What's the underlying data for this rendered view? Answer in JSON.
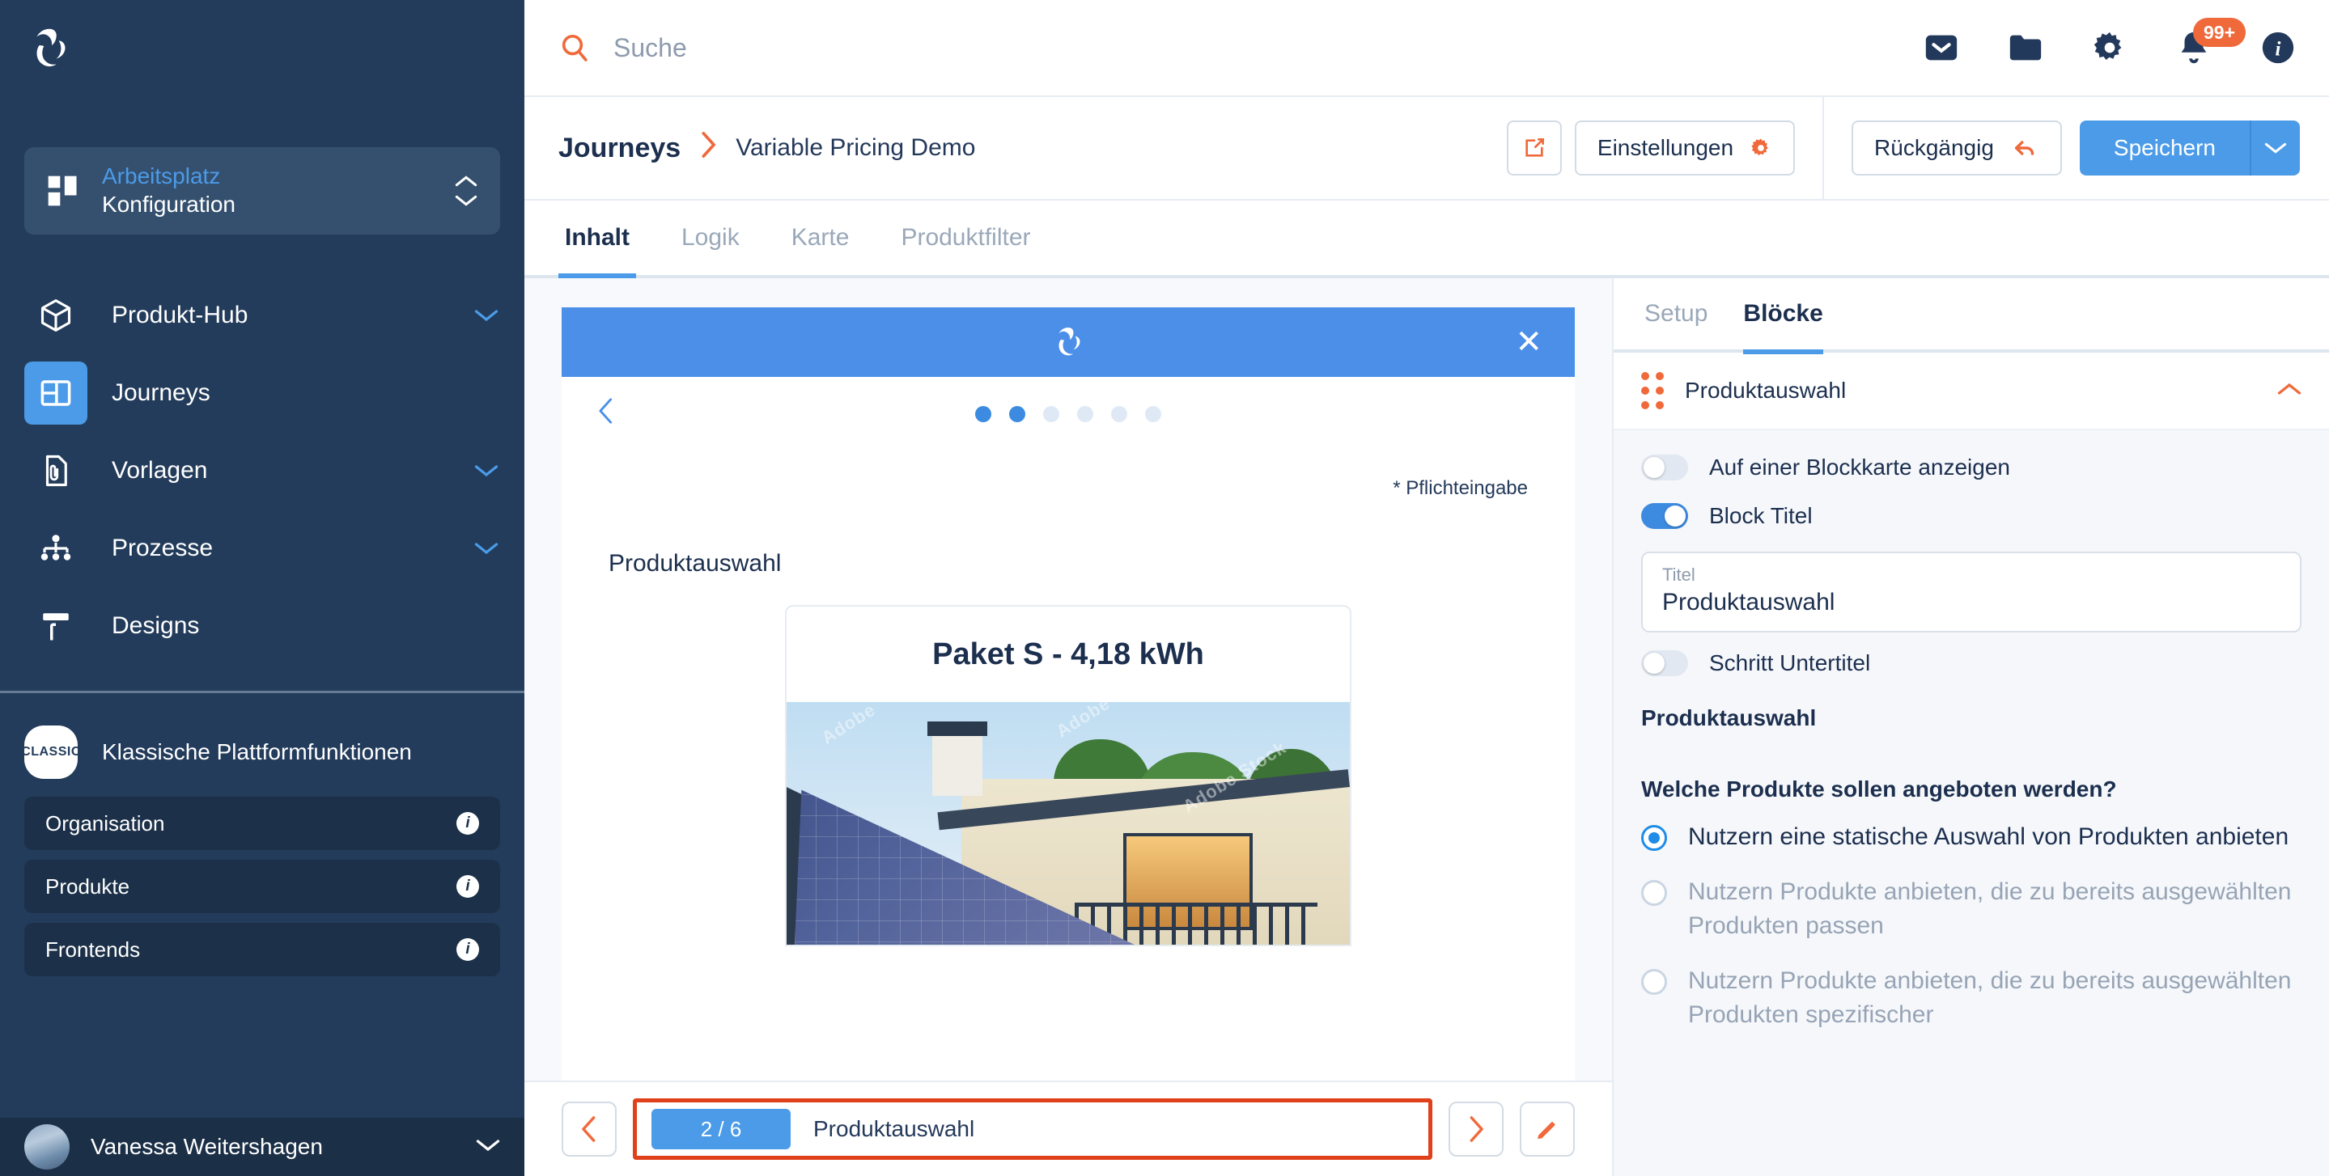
{
  "sidebar": {
    "logo_icon": "refresh-loop-logo",
    "workspace": {
      "icon": "dashboard-grid-icon",
      "top_label": "Arbeitsplatz",
      "bottom_label": "Konfiguration",
      "chevron_up_icon": "chevron-up-icon",
      "chevron_down_icon": "chevron-down-icon"
    },
    "nav_items": [
      {
        "label": "Produkt-Hub",
        "icon": "cube-icon",
        "active": false,
        "has_chevron": true
      },
      {
        "label": "Journeys",
        "icon": "layout-panels-icon",
        "active": true,
        "has_chevron": false
      },
      {
        "label": "Vorlagen",
        "icon": "document-clip-icon",
        "active": false,
        "has_chevron": true
      },
      {
        "label": "Prozesse",
        "icon": "org-tree-icon",
        "active": false,
        "has_chevron": true
      },
      {
        "label": "Designs",
        "icon": "paint-roller-icon",
        "active": false,
        "has_chevron": false
      }
    ],
    "classic": {
      "badge": "CLASSIC",
      "title": "Klassische Plattformfunktionen",
      "items": [
        {
          "label": "Organisation",
          "info_icon": "info-icon"
        },
        {
          "label": "Produkte",
          "info_icon": "info-icon"
        },
        {
          "label": "Frontends",
          "info_icon": "info-icon"
        }
      ]
    },
    "user": {
      "name": "Vanessa Weitershagen",
      "chevron_icon": "chevron-down-icon"
    }
  },
  "topbar": {
    "search_icon": "search-icon",
    "search_placeholder": "Suche",
    "search_value": "",
    "icons": [
      {
        "name": "mail-icon",
        "badge": ""
      },
      {
        "name": "folder-icon",
        "badge": ""
      },
      {
        "name": "gear-icon",
        "badge": ""
      },
      {
        "name": "bell-icon",
        "badge": "99+"
      },
      {
        "name": "info-circle-icon",
        "badge": ""
      }
    ],
    "notification_badge": "99+",
    "badge_color": "#F0693B"
  },
  "breadcrumb": {
    "root": "Journeys",
    "separator_icon": "chevron-right-icon",
    "current": "Variable Pricing Demo"
  },
  "toolbar": {
    "open_external_icon": "external-link-icon",
    "settings_label": "Einstellungen",
    "settings_icon": "gear-icon",
    "undo_label": "Rückgängig",
    "undo_icon": "undo-arrow-icon",
    "save_label": "Speichern",
    "save_caret_icon": "chevron-down-icon",
    "accent_blue": "#4B9BE8",
    "accent_orange": "#F0693B"
  },
  "tabs": [
    {
      "label": "Inhalt",
      "active": true
    },
    {
      "label": "Logik",
      "active": false
    },
    {
      "label": "Karte",
      "active": false
    },
    {
      "label": "Produktfilter",
      "active": false
    }
  ],
  "preview": {
    "header_logo_icon": "refresh-loop-logo",
    "close_icon": "close-icon",
    "prev_icon": "chevron-left-icon",
    "dots_total": 6,
    "dots_active": [
      1,
      2
    ],
    "required_note": "* Pflichteingabe",
    "section_title": "Produktauswahl",
    "product_card": {
      "title": "Paket S - 4,18 kWh",
      "image_alt": "solar-panel-house-photo",
      "watermark": "Adobe Stock"
    }
  },
  "step_bar": {
    "prev_icon": "chevron-left-icon",
    "next_icon": "chevron-right-icon",
    "edit_icon": "pencil-icon",
    "counter": "2 / 6",
    "step_name": "Produktauswahl",
    "highlight_color": "#E0401A"
  },
  "right_panel": {
    "tabs": [
      {
        "label": "Setup",
        "active": false
      },
      {
        "label": "Blöcke",
        "active": true
      }
    ],
    "block": {
      "grip_icon": "drag-grip-icon",
      "title": "Produktauswahl",
      "collapse_icon": "chevron-up-icon"
    },
    "toggles": [
      {
        "label": "Auf einer Blockkarte anzeigen",
        "on": false
      },
      {
        "label": "Block Titel",
        "on": true
      }
    ],
    "title_field": {
      "label": "Titel",
      "value": "Produktauswahl"
    },
    "subtitle_toggle": {
      "label": "Schritt Untertitel",
      "on": false
    },
    "section_heading": "Produktauswahl",
    "question": "Welche Produkte sollen angeboten werden?",
    "options": [
      {
        "text": "Nutzern eine statische Auswahl von Produkten anbieten",
        "selected": true,
        "enabled": true
      },
      {
        "text": "Nutzern Produkte anbieten, die zu bereits ausgewählten Produkten passen",
        "selected": false,
        "enabled": false
      },
      {
        "text": "Nutzern Produkte anbieten, die zu bereits ausgewählten Produkten spezifischer",
        "selected": false,
        "enabled": false
      }
    ]
  }
}
